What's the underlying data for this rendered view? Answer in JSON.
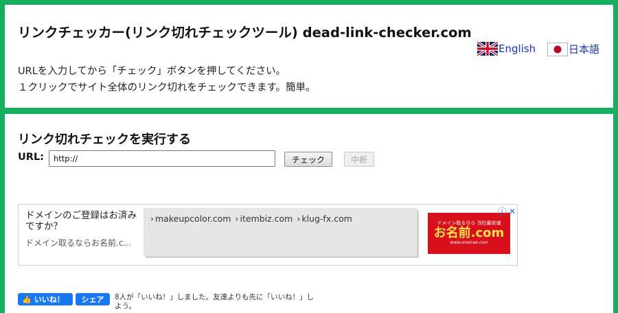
{
  "header": {
    "title": "リンクチェッカー(リンク切れチェックツール) dead-link-checker.com",
    "languages": [
      {
        "label": "English",
        "icon": "uk-flag-icon"
      },
      {
        "label": "日本語",
        "icon": "japan-flag-icon"
      }
    ],
    "description": [
      "URLを入力してから「チェック」ボタンを押してください。",
      "１クリックでサイト全体のリンク切れをチェックできます。簡単。"
    ]
  },
  "checker": {
    "section_title": "リンク切れチェックを実行する",
    "url_label": "URL:",
    "url_value": "http://",
    "check_button": "チェック",
    "stop_button": "中断"
  },
  "ad": {
    "headline": "ドメインのご登録はお済みですか？",
    "sub": "ドメイン取るならお名前.c...",
    "breadcrumb": [
      "makeupcolor.com",
      "itembiz.com",
      "klug-fx.com"
    ],
    "banner_small": "ドメイン取るなら 当社最安値",
    "banner_big": "お名前.com",
    "banner_tiny": "www.onamae.com",
    "choices_icon": "info-icon",
    "close_icon": "close-icon"
  },
  "social": {
    "like_label": "いいね！",
    "share_label": "シェア",
    "count_text": "8人が「いいね！」しました。友達よりも先に「いいね！」しよう。"
  },
  "colors": {
    "frame_green": "#14b060",
    "link_blue": "#1a35b8",
    "facebook_blue": "#1877f2",
    "banner_red": "#d7101c"
  }
}
